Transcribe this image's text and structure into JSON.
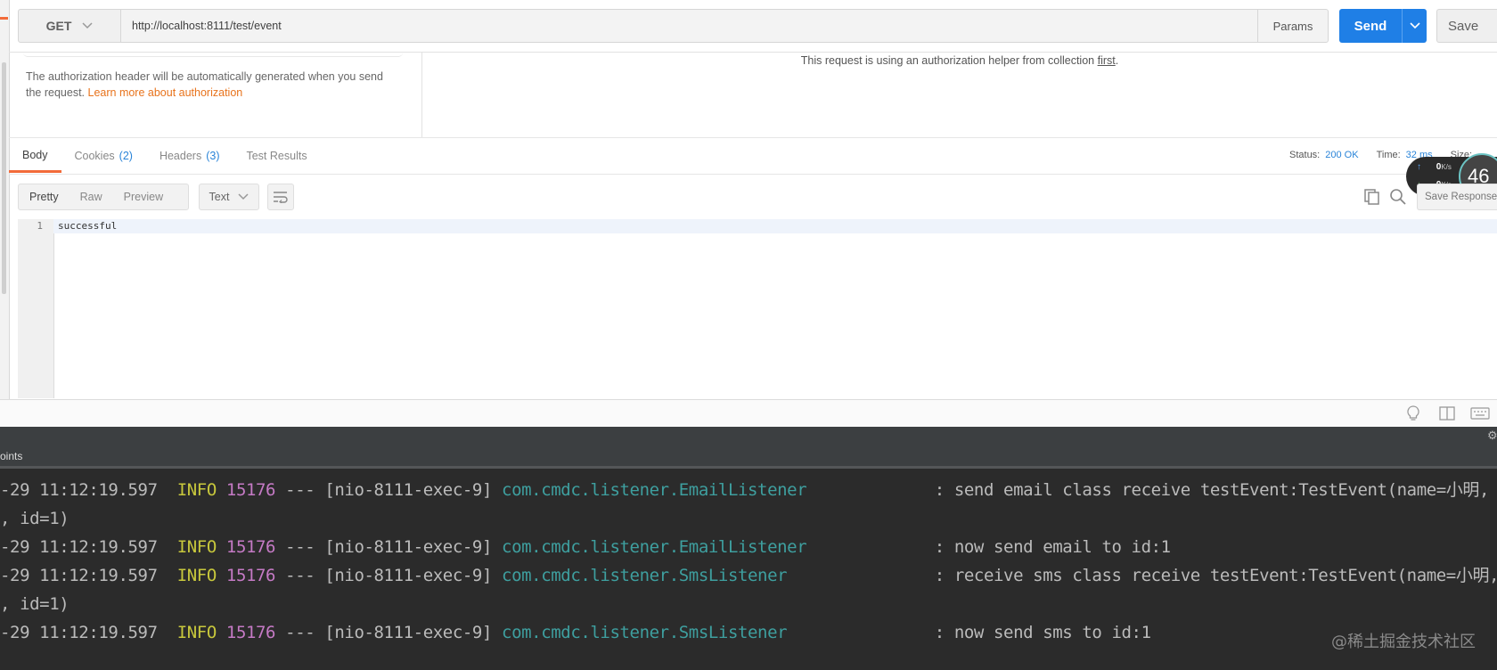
{
  "request": {
    "method": "GET",
    "url": "http://localhost:8111/test/event",
    "params_label": "Params",
    "send_label": "Send",
    "save_label": "Save"
  },
  "auth": {
    "description": "The authorization header will be automatically generated when you send the request.",
    "learn_more": "Learn more about authorization",
    "helper_text": "This request is using an authorization helper from collection",
    "helper_link": "first",
    "helper_end": "."
  },
  "response": {
    "tabs": [
      {
        "label": "Body",
        "count": ""
      },
      {
        "label": "Cookies",
        "count": "(2)"
      },
      {
        "label": "Headers",
        "count": "(3)"
      },
      {
        "label": "Test Results",
        "count": ""
      }
    ],
    "status_label": "Status:",
    "status_value": "200 OK",
    "time_label": "Time:",
    "time_value": "32 ms",
    "size_label": "Size:",
    "view_options": [
      "Pretty",
      "Raw",
      "Preview"
    ],
    "format": "Text",
    "save_response_label": "Save Response",
    "body_lines": [
      {
        "number": "1",
        "text": "successful"
      }
    ]
  },
  "net_widget": {
    "up": "0",
    "down": "0",
    "unit": "K/s",
    "value": "46"
  },
  "console": {
    "tab_label": "oints",
    "lines": [
      {
        "date": "-29 11:12:19.597",
        "level": "INFO",
        "pid": "15176",
        "sep": "---",
        "thread": "[nio-8111-exec-9]",
        "logger": "com.cmdc.listener.EmailListener",
        "message": ": send email class receive testEvent:TestEvent(name=小明,"
      },
      {
        "continuation": ", id=1)"
      },
      {
        "date": "-29 11:12:19.597",
        "level": "INFO",
        "pid": "15176",
        "sep": "---",
        "thread": "[nio-8111-exec-9]",
        "logger": "com.cmdc.listener.EmailListener",
        "message": ": now send email to id:1"
      },
      {
        "date": "-29 11:12:19.597",
        "level": "INFO",
        "pid": "15176",
        "sep": "---",
        "thread": "[nio-8111-exec-9]",
        "logger": "com.cmdc.listener.SmsListener",
        "message": ": receive sms class receive testEvent:TestEvent(name=小明,"
      },
      {
        "continuation": ", id=1)"
      },
      {
        "date": "-29 11:12:19.597",
        "level": "INFO",
        "pid": "15176",
        "sep": "---",
        "thread": "[nio-8111-exec-9]",
        "logger": "com.cmdc.listener.SmsListener",
        "message": ": now send sms to id:1"
      }
    ],
    "watermark": "@稀土掘金技术社区"
  },
  "colors": {
    "send_blue": "#1f7fe6",
    "tab_accent": "#f26b3a",
    "link_orange": "#e8731c",
    "status_blue": "#2a84d8",
    "console_bg": "#2b2b2b",
    "log_info": "#c8c83c",
    "log_pid": "#c57ac5",
    "log_logger": "#3e9f9f"
  },
  "icons": [
    "chevron-down-icon",
    "wrap-lines-icon",
    "copy-icon",
    "search-icon",
    "bulb-icon",
    "columns-icon",
    "keyboard-icon",
    "gear-icon",
    "arrow-up-icon",
    "arrow-down-icon"
  ]
}
